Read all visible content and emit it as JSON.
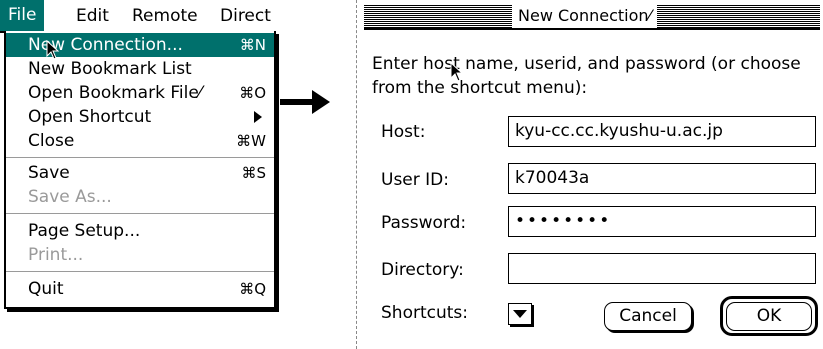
{
  "menubar": {
    "items": [
      "File",
      "Edit",
      "Remote",
      "Direct"
    ]
  },
  "file_menu": {
    "items": [
      {
        "label": "New Connection...",
        "shortcut": "⌘N"
      },
      {
        "label": "New Bookmark List",
        "shortcut": ""
      },
      {
        "label": "Open Bookmark File⁄",
        "shortcut": "⌘O"
      },
      {
        "label": "Open Shortcut",
        "shortcut": ""
      },
      {
        "label": "Close",
        "shortcut": "⌘W"
      },
      {
        "label": "Save",
        "shortcut": "⌘S"
      },
      {
        "label": "Save As...",
        "shortcut": ""
      },
      {
        "label": "Page Setup...",
        "shortcut": ""
      },
      {
        "label": "Print...",
        "shortcut": ""
      },
      {
        "label": "Quit",
        "shortcut": "⌘Q"
      }
    ]
  },
  "dialog": {
    "title": "New Connection⁄",
    "prompt": "Enter host name, userid, and password (or choose from the shortcut menu):",
    "labels": {
      "host": "Host:",
      "user": "User ID:",
      "password": "Password:",
      "directory": "Directory:",
      "shortcuts": "Shortcuts:"
    },
    "values": {
      "host": "kyu-cc.cc.kyushu-u.ac.jp",
      "user": "k70043a",
      "password": "••••••••",
      "directory": ""
    },
    "buttons": {
      "cancel": "Cancel",
      "ok": "OK"
    }
  },
  "colors": {
    "highlight": "#00706c"
  }
}
